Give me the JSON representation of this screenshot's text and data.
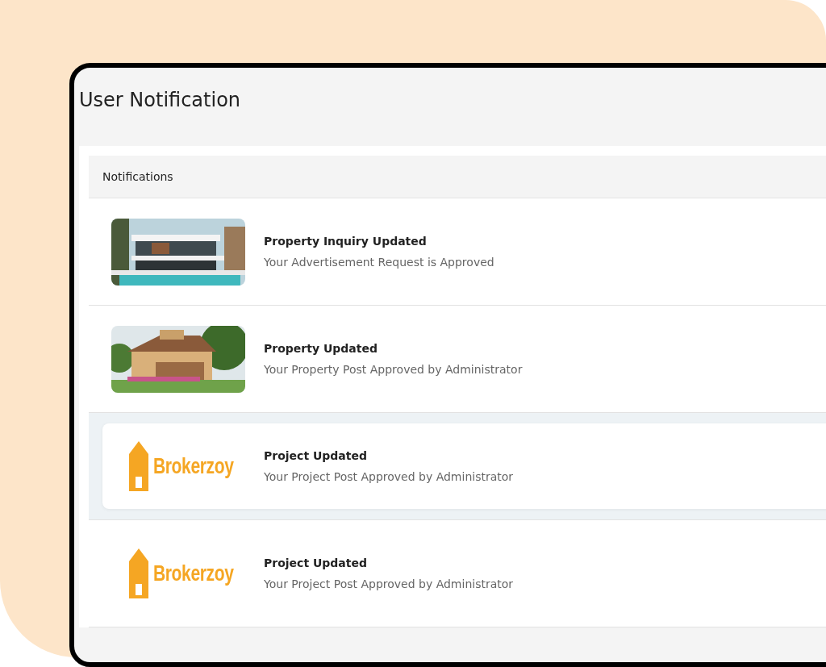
{
  "page": {
    "title": "User Notification"
  },
  "panel": {
    "heading": "Notifications"
  },
  "notifications": [
    {
      "title": "Property Inquiry Updated",
      "message": "Your Advertisement Request is Approved",
      "highlighted": false
    },
    {
      "title": "Property Updated",
      "message": "Your Property Post Approved by Administrator",
      "highlighted": false
    },
    {
      "thumbnail": {
        "kind": "logo",
        "text": "Brokerzoy"
      },
      "title": "Project Updated",
      "message": "Your Project Post Approved by Administrator",
      "highlighted": true
    },
    {
      "thumbnail": {
        "kind": "logo",
        "text": "Brokerzoy"
      },
      "title": "Project Updated",
      "message": "Your Project Post Approved by Administrator",
      "highlighted": false
    }
  ]
}
